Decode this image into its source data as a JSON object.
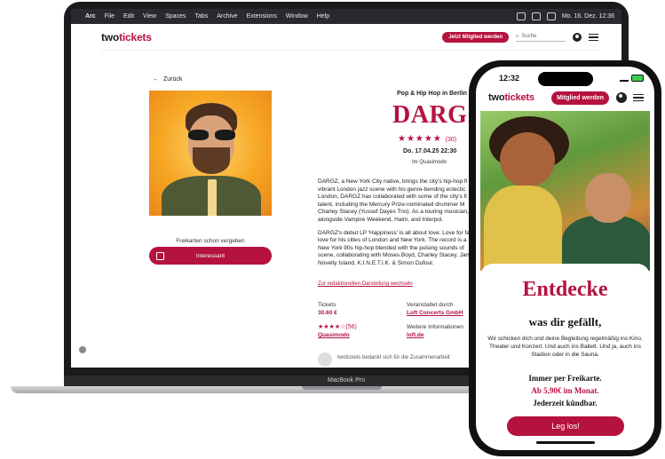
{
  "mac_menubar": {
    "app": "Arc",
    "items": [
      "File",
      "Edit",
      "View",
      "Spaces",
      "Tabs",
      "Archive",
      "Extensions",
      "Window",
      "Help"
    ],
    "clock": "Mo. 16. Dez. 12:36"
  },
  "site": {
    "logo_prefix": "two",
    "logo_suffix": "tickets",
    "join_button": "Jetzt Mitglied werden",
    "search_placeholder": "Suche"
  },
  "event": {
    "back_label": "Zurück",
    "genre": "Pop & Hip Hop in Berlin",
    "artist": "DARGZ",
    "rating_count": "(30)",
    "date": "Do. 17.04.25 22:30",
    "venue": "Im Quasimodo",
    "description_1": "DARGZ, a New York City native, brings the city's hip-hop fl vibrant London jazz scene with his genre-bending eclectic London, DARGZ has collaborated with some of the city's fi talent, including the Mercury Prize-nominated drummer M Charley Stacey (Yussef Dayes Trio). As a touring musician, alongside Vampire Weekend, Haim, and Interpol.",
    "description_2": "DARGZ's debut LP 'Happiness' is all about love: Love for fa love for his cities of London and New York. The record is a New York 90s hip-hop blended with the pulsing sounds of scene, collaborating with Moses Boyd, Charley Stacey, Jam Novelty Island, K.I.N.E.T.I.K. & Simon Dufour.",
    "redaction_link": "Zur redaktionellen Darstellung wechseln",
    "freikarten_text": "Freikarten schon vergeben",
    "interest_button": "Interessant",
    "tickets_label": "Tickets",
    "tickets_price": "30.60 €",
    "organizer_label": "Veranstaltet durch",
    "organizer_link": "Loft Concerts GmbH",
    "venue_rating_count": "(56)",
    "venue_link": "Quasimodo",
    "more_info_label": "Weitere Informationen",
    "more_info_link": "loft.de",
    "footer_note": "twotickets bedankt sich für die Zusammenarbeit"
  },
  "laptop": {
    "model_label": "MacBook Pro"
  },
  "phone": {
    "time": "12:32",
    "logo_prefix": "two",
    "logo_suffix": "tickets",
    "join_button": "Mitglied werden",
    "headline": "Entdecke",
    "subheadline": "was dir gefällt,",
    "body": "Wir schicken dich und deine Begleitung regelmäßig ins Kino, Theater und Konzert. Und auch ins Ballett. Und ja, auch ins Stadion oder in die Sauna.",
    "line1": "Immer per Freikarte.",
    "line2": "Ab 5,90€ im Monat.",
    "line3": "Jederzeit kündbar.",
    "cta": "Leg los!"
  },
  "colors": {
    "brand": "#b5123f",
    "text": "#222222"
  }
}
